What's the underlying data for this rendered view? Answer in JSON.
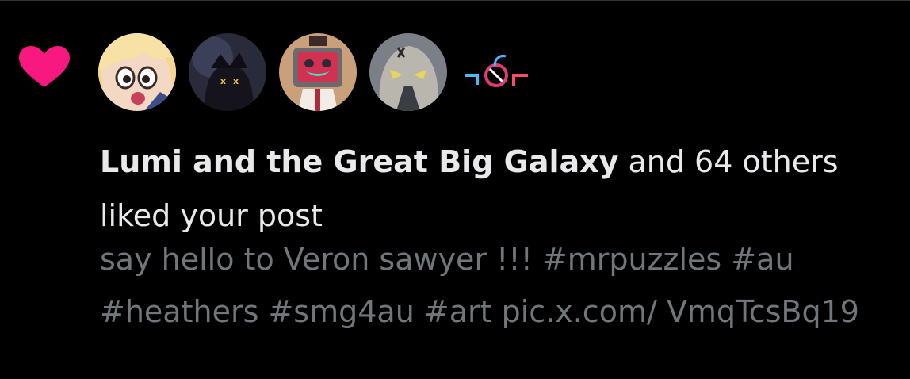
{
  "notification": {
    "type_icon": "heart-icon",
    "accent_color": "#f91880",
    "avatars": [
      {
        "name": "avatar-1",
        "description_icon": "cartoon-girl-avatar"
      },
      {
        "name": "avatar-2",
        "description_icon": "dark-character-avatar"
      },
      {
        "name": "avatar-3",
        "description_icon": "tv-head-avatar"
      },
      {
        "name": "avatar-4",
        "description_icon": "grey-creature-avatar"
      }
    ],
    "logo_icon": "neon-logo-icon",
    "actor_name": "Lumi and the Great Big Galaxy",
    "action_text": " and 64 others liked your post",
    "post_text": "say hello to Veron sawyer !!! #mrpuzzles #au #heathers #smg4au #art pic.x.com/ VmqTcsBq19"
  },
  "colors": {
    "background": "#000000",
    "primary_text": "#e7e9ea",
    "secondary_text": "#71767b",
    "divider": "#2f3336"
  }
}
